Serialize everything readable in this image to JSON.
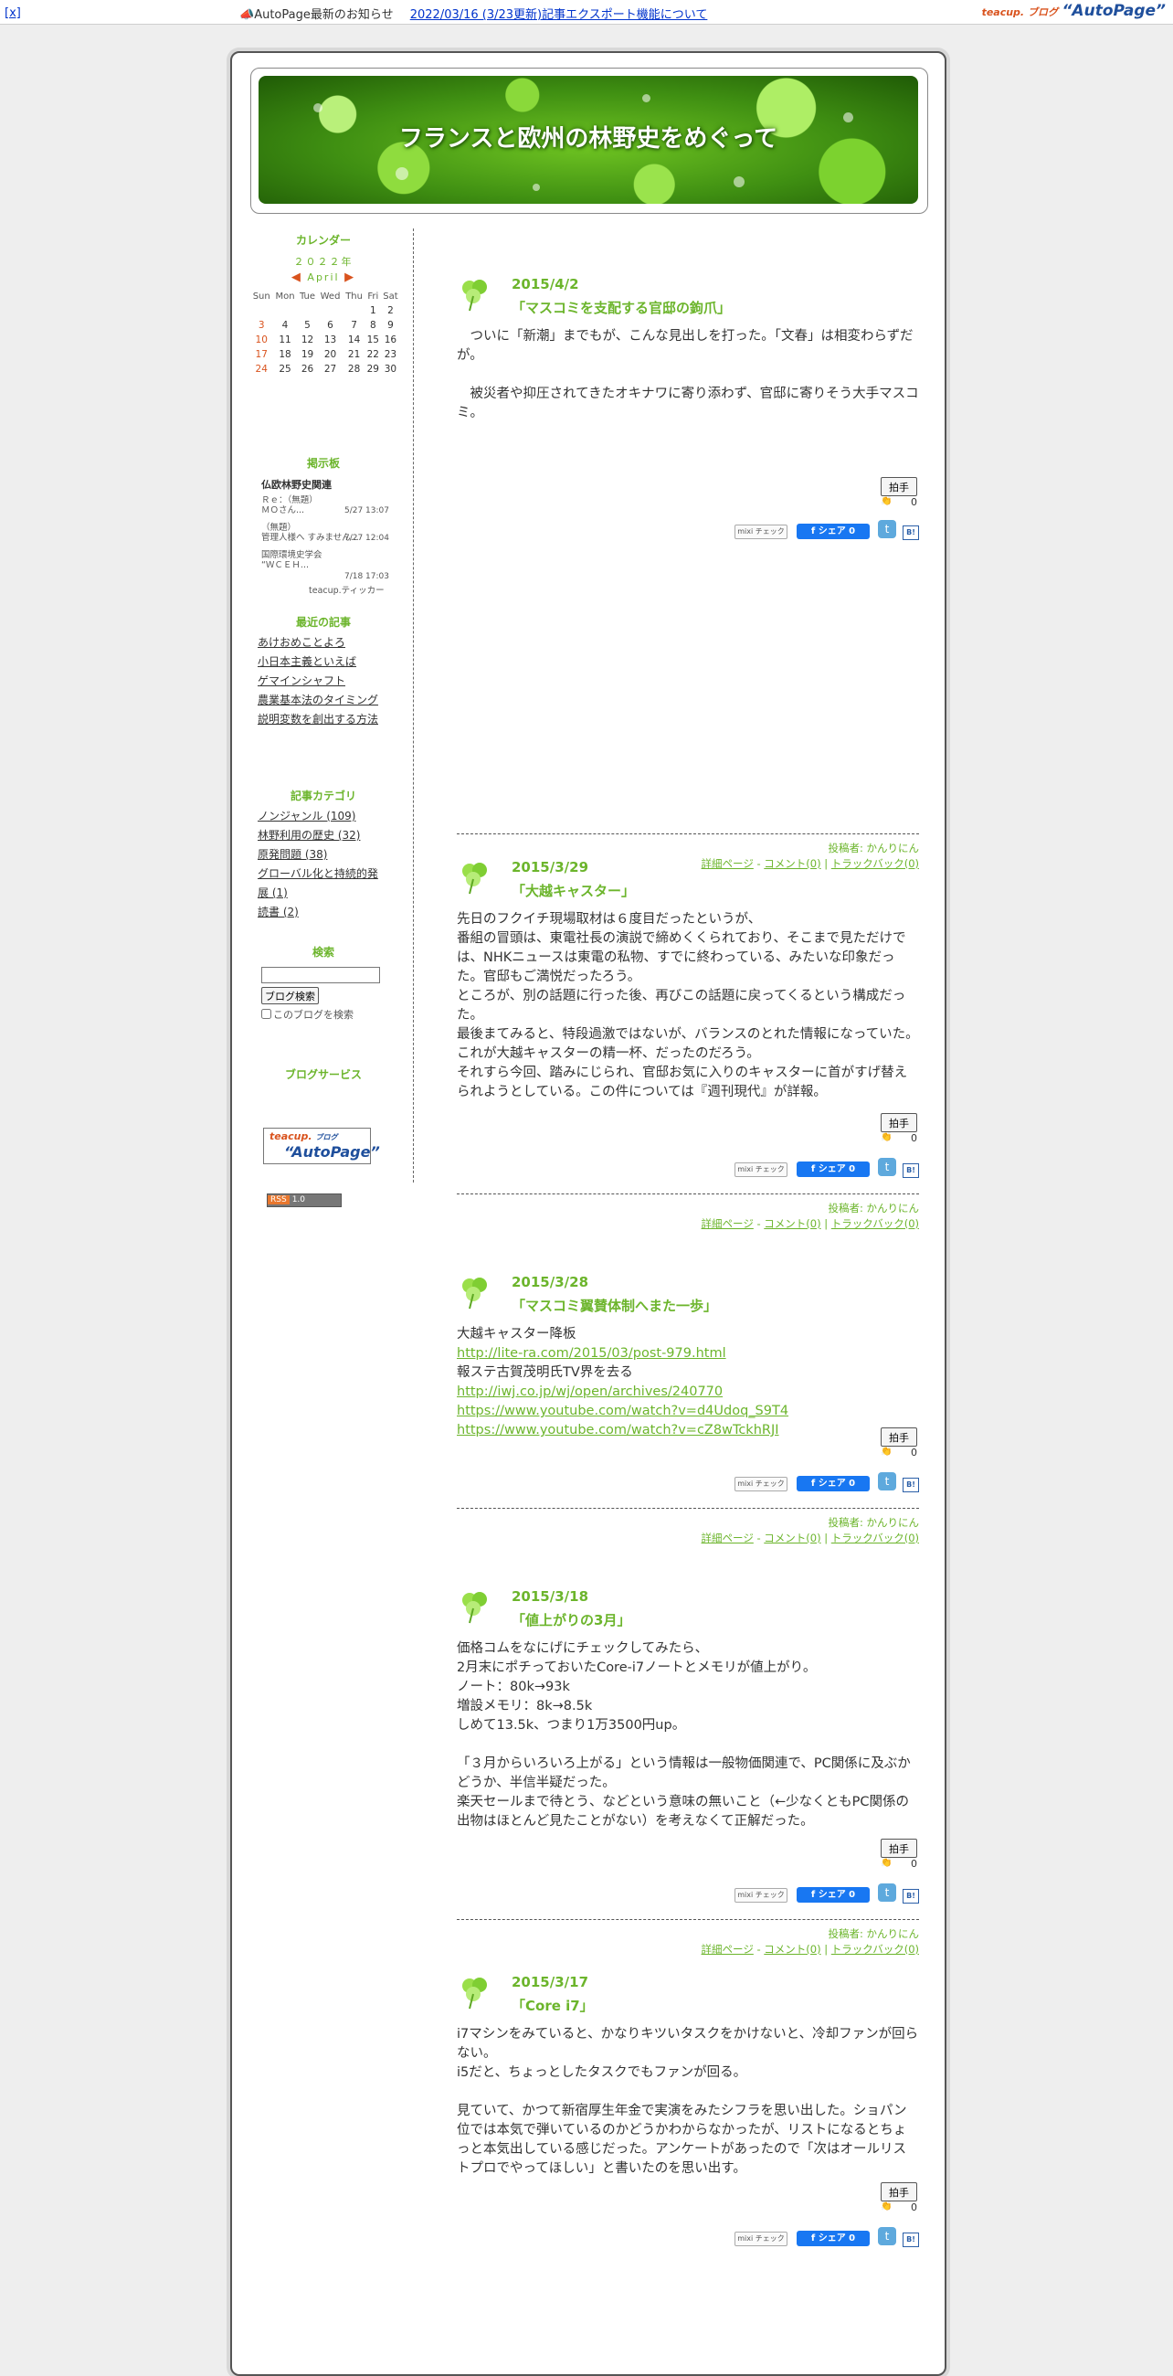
{
  "topbar": {
    "close": "[x]",
    "notice_label": "AutoPage最新のお知らせ",
    "notice_link": "2022/03/16 (3/23更新)記事エクスポート機能について",
    "brand_teacup": "teacup. ブログ",
    "brand_autopage": "“AutoPage”"
  },
  "site": {
    "title": "フランスと欧州の林野史をめぐって"
  },
  "sidebar": {
    "calendar": {
      "title": "カレンダー",
      "year": "２０２２年",
      "month": "April",
      "weekdays": [
        "Sun",
        "Mon",
        "Tue",
        "Wed",
        "Thu",
        "Fri",
        "Sat"
      ],
      "weeks": [
        [
          "",
          "",
          "",
          "",
          "",
          "1",
          "2"
        ],
        [
          "3",
          "4",
          "5",
          "6",
          "7",
          "8",
          "9"
        ],
        [
          "10",
          "11",
          "12",
          "13",
          "14",
          "15",
          "16"
        ],
        [
          "17",
          "18",
          "19",
          "20",
          "21",
          "22",
          "23"
        ],
        [
          "24",
          "25",
          "26",
          "27",
          "28",
          "29",
          "30"
        ]
      ]
    },
    "bbs": {
      "title": "掲示板",
      "name": "仏欧林野史関連",
      "entries": [
        {
          "text": "Ｒｅ：（無題）\nＭＯさん...",
          "date": "5/27 13:07"
        },
        {
          "text": "（無題）\n管理人様へ すみません...",
          "date": "7/27 12:04"
        },
        {
          "text": "国際環境史学会\n“ＷＣＥＨ...",
          "date": "7/18 17:03"
        }
      ],
      "ticker": "teacup.ティッカー"
    },
    "recent": {
      "title": "最近の記事",
      "items": [
        "あけおめことよろ",
        "小日本主義といえば",
        "ゲマインシャフト",
        "農業基本法のタイミング",
        "説明変数を創出する方法"
      ]
    },
    "categories": {
      "title": "記事カテゴリ",
      "items": [
        "ノンジャンル (109)",
        "林野利用の歴史 (32)",
        "原発問題 (38)",
        "グローバル化と持続的発展 (1)",
        "読書 (2)"
      ]
    },
    "search": {
      "title": "検索",
      "value": "",
      "button": "ブログ検索",
      "option": "このブログを検索"
    },
    "services": {
      "title": "ブログサービス",
      "badge_teacup": "teacup.",
      "badge_blog": "ブログ",
      "badge_autopage": "“AutoPage”",
      "rss": "RSS",
      "rss_ver": "1.0"
    }
  },
  "posts": [
    {
      "date": "2015/4/2",
      "title": "「マスコミを支配する官邸の鉤爪」",
      "paragraphs": [
        "　ついに「新潮」までもが、こんな見出しを打った。「文春」は相変わらずだが。",
        "",
        "　被災者や抑圧されてきたオキナワに寄り添わず、官邸に寄りそう大手マスコミ。"
      ],
      "author": "投稿者: かんりにん"
    },
    {
      "date": "2015/3/29",
      "title": "「大越キャスター」",
      "paragraphs": [
        "先日のフクイチ現場取材は６度目だったというが、",
        "番組の冒頭は、東電社長の演説で締めくくられており、そこまで見ただけでは、NHKニュースは東電の私物、すでに終わっている、みたいな印象だった。官邸もご満悦だったろう。",
        "ところが、別の話題に行った後、再びこの話題に戻ってくるという構成だった。",
        "最後まてみると、特段過激ではないが、バランスのとれた情報になっていた。",
        "これが大越キャスターの精一杯、だったのだろう。",
        "それすら今回、踏みにじられ、官邸お気に入りのキャスターに首がすげ替えられようとしている。この件については『週刊現代』が詳報。"
      ],
      "author": "投稿者: かんりにん"
    },
    {
      "date": "2015/3/28",
      "title": "「マスコミ翼賛体制へまた一歩」",
      "lines": [
        {
          "text": "大越キャスター降板",
          "link": false
        },
        {
          "text": "http://lite-ra.com/2015/03/post-979.html",
          "link": true
        },
        {
          "text": "報ステ古賀茂明氏TV界を去る",
          "link": false
        },
        {
          "text": "http://iwj.co.jp/wj/open/archives/240770",
          "link": true
        },
        {
          "text": "https://www.youtube.com/watch?v=d4Udoq_S9T4",
          "link": true
        },
        {
          "text": "https://www.youtube.com/watch?v=cZ8wTckhRJI",
          "link": true
        }
      ],
      "author": "投稿者: かんりにん"
    },
    {
      "date": "2015/3/18",
      "title": "「値上がりの3月」",
      "paragraphs": [
        "価格コムをなにげにチェックしてみたら、",
        "2月末にポチっておいたCore-i7ノートとメモリが値上がり。",
        "ノート：80k→93k",
        "増設メモリ：8k→8.5k",
        "しめて13.5k、つまり1万3500円up。",
        "",
        "「３月からいろいろ上がる」という情報は一般物価関連で、PC関係に及ぶかどうか、半信半疑だった。",
        "楽天セールまで待とう、などという意味の無いこと（←少なくともPC関係の出物はほとんど見たことがない）を考えなくて正解だった。"
      ],
      "author": "投稿者: かんりにん"
    },
    {
      "date": "2015/3/17",
      "title": "「Core i7」",
      "paragraphs": [
        "i7マシンをみていると、かなりキツいタスクをかけないと、冷却ファンが回らない。",
        "i5だと、ちょっとしたタスクでもファンが回る。",
        "",
        "見ていて、かつて新宿厚生年金で実演をみたシフラを思い出した。ショパン位では本気で弾いているのかどうかわからなかったが、リストになるとちょっと本気出している感じだった。アンケートがあったので「次はオールリストプロでやってほしい」と書いたのを思い出す。"
      ],
      "author": ""
    }
  ],
  "post_ui": {
    "clap": "拍手",
    "clap_count": "0",
    "mixi": "mixi チェック",
    "fb_share": "f シェア 0",
    "tw": "t",
    "hb": "B!",
    "detail": "詳細ページ",
    "comment": "コメント(0)",
    "trackback": "トラックバック(0)",
    "sep1": " - ",
    "sep2": " | "
  }
}
